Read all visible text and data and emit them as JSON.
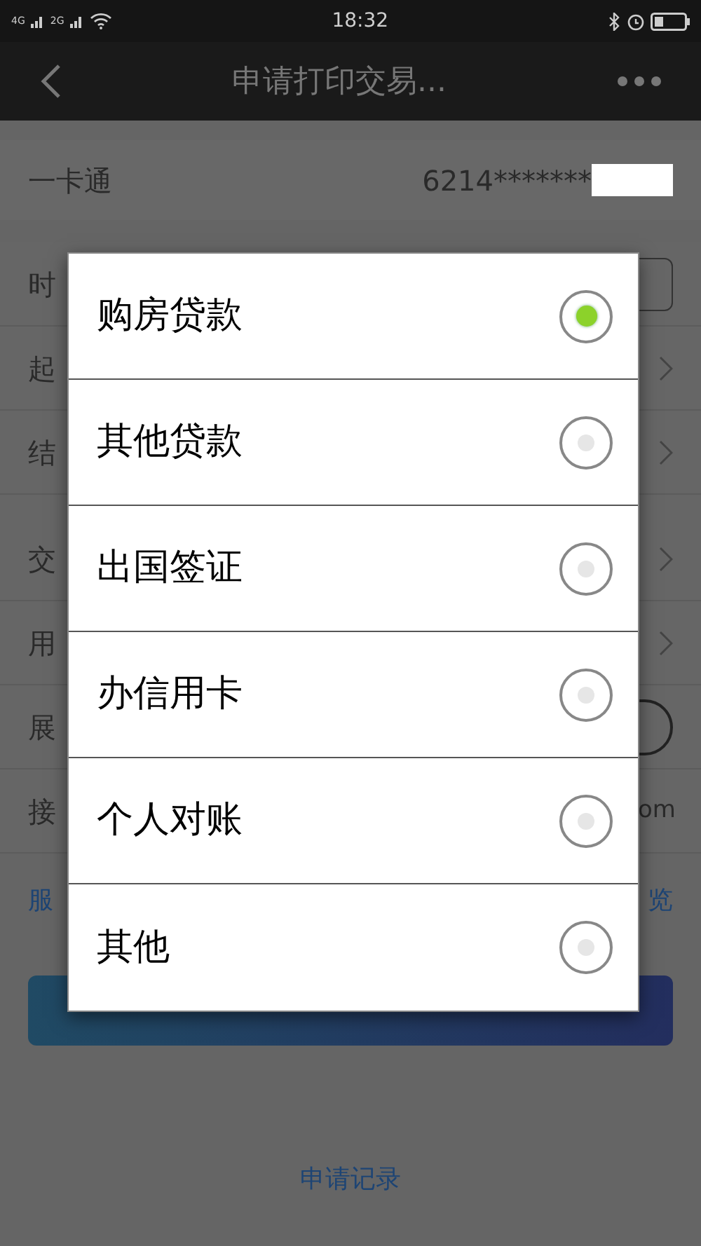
{
  "status_bar": {
    "network_1": "4G",
    "network_2": "2G",
    "time": "18:32"
  },
  "nav_bar": {
    "title": "申请打印交易..."
  },
  "card_row": {
    "label": "一卡通",
    "value": "6214*******"
  },
  "rows": [
    {
      "label": "时",
      "kind": "button"
    },
    {
      "label": "起",
      "kind": "chevron"
    },
    {
      "label": "结",
      "kind": "chevron"
    },
    {
      "label": "交",
      "kind": "chevron"
    },
    {
      "label": "用",
      "kind": "chevron"
    },
    {
      "label": "展",
      "kind": "switch",
      "on": false
    },
    {
      "label": "接",
      "kind": "text",
      "value": "om"
    }
  ],
  "links_row": {
    "left": "服",
    "right": "览"
  },
  "records_link": "申请记录",
  "dialog": {
    "options": [
      {
        "label": "购房贷款",
        "selected": true
      },
      {
        "label": "其他贷款",
        "selected": false
      },
      {
        "label": "出国签证",
        "selected": false
      },
      {
        "label": "办信用卡",
        "selected": false
      },
      {
        "label": "个人对账",
        "selected": false
      },
      {
        "label": "其他",
        "selected": false
      }
    ]
  }
}
